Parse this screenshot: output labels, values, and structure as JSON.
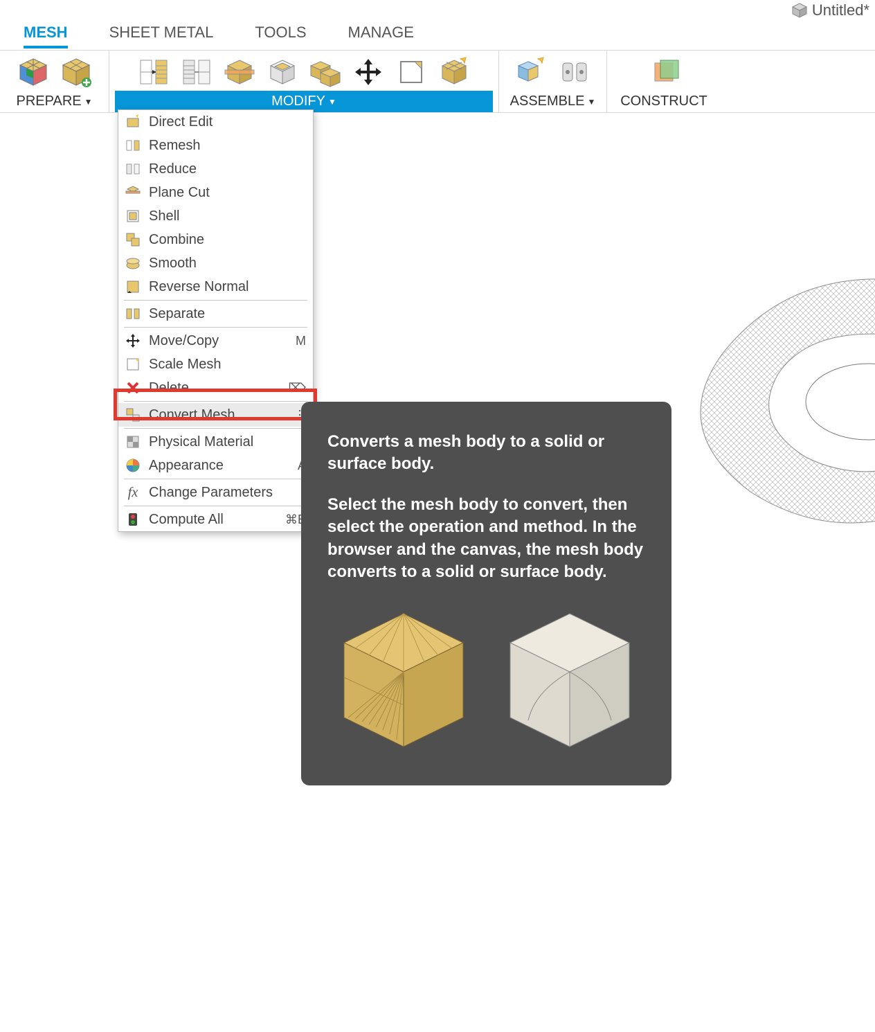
{
  "window": {
    "title": "Untitled*"
  },
  "tabs": {
    "mesh": "MESH",
    "sheet_metal": "SHEET METAL",
    "tools": "TOOLS",
    "manage": "MANAGE"
  },
  "ribbon": {
    "prepare": "PREPARE",
    "modify": "MODIFY",
    "assemble": "ASSEMBLE",
    "construct": "CONSTRUCT"
  },
  "menu": {
    "direct_edit": "Direct Edit",
    "remesh": "Remesh",
    "reduce": "Reduce",
    "plane_cut": "Plane Cut",
    "shell": "Shell",
    "combine": "Combine",
    "smooth": "Smooth",
    "reverse_normal": "Reverse Normal",
    "separate": "Separate",
    "move_copy": "Move/Copy",
    "move_copy_key": "M",
    "scale_mesh": "Scale Mesh",
    "delete": "Delete",
    "delete_key": "⌦",
    "convert_mesh": "Convert Mesh",
    "convert_mesh_more": "⋮",
    "physical_material": "Physical Material",
    "appearance": "Appearance",
    "appearance_key": "A",
    "change_parameters": "Change Parameters",
    "compute_all": "Compute All",
    "compute_all_key": "⌘B"
  },
  "tooltip": {
    "line1": "Converts a mesh body to a solid or surface body.",
    "line2": "Select the mesh body to convert, then select the operation and method. In the browser and the canvas, the mesh body converts to a solid or surface body."
  }
}
